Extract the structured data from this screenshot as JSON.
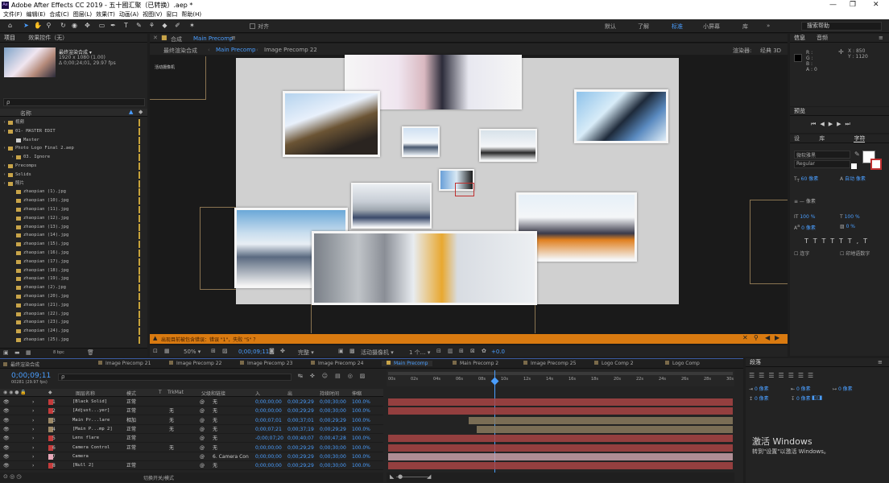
{
  "window": {
    "title": "Adobe After Effects CC 2019 - 五十國汇聚（已转换）.aep *",
    "logo": "Ae"
  },
  "menu": [
    "文件(F)",
    "编辑(E)",
    "合成(C)",
    "图层(L)",
    "效果(T)",
    "动画(A)",
    "视图(V)",
    "窗口",
    "帮助(H)"
  ],
  "toolbar": {
    "align_label": "对齐",
    "workspaces": [
      "默认",
      "了解",
      "标准",
      "小屏幕",
      "库"
    ],
    "active_workspace": "标准",
    "search_placeholder": "搜索帮助",
    "chevron": "»"
  },
  "project": {
    "tab_project": "项目",
    "tab_effects": "效果控件（无）",
    "comp_name": "最终渲染合成",
    "comp_res": "1920 x 1080 (1.00)",
    "comp_dur": "Δ 0;00;24;01, 29.97 fps",
    "search_icon": "ρ",
    "col_name": "名称",
    "items": [
      {
        "label": "视频",
        "type": "folder",
        "indent": 0
      },
      {
        "label": "01- MASTER EDIT",
        "type": "folder",
        "indent": 0
      },
      {
        "label": "Master",
        "type": "comp",
        "indent": 1
      },
      {
        "label": "Photo Logo Final 2.aep",
        "type": "folder",
        "indent": 0
      },
      {
        "label": "03. Ignore",
        "type": "folder",
        "indent": 1
      },
      {
        "label": "Precomps",
        "type": "folder",
        "indent": 0
      },
      {
        "label": "Solids",
        "type": "folder",
        "indent": 0
      },
      {
        "label": "照片",
        "type": "folder",
        "indent": 0
      },
      {
        "label": "zhaopian (1).jpg",
        "type": "jpg",
        "indent": 1
      },
      {
        "label": "zhaopian (10).jpg",
        "type": "jpg",
        "indent": 1
      },
      {
        "label": "zhaopian (11).jpg",
        "type": "jpg",
        "indent": 1
      },
      {
        "label": "zhaopian (12).jpg",
        "type": "jpg",
        "indent": 1
      },
      {
        "label": "zhaopian (13).jpg",
        "type": "jpg",
        "indent": 1
      },
      {
        "label": "zhaopian (14).jpg",
        "type": "jpg",
        "indent": 1
      },
      {
        "label": "zhaopian (15).jpg",
        "type": "jpg",
        "indent": 1
      },
      {
        "label": "zhaopian (16).jpg",
        "type": "jpg",
        "indent": 1
      },
      {
        "label": "zhaopian (17).jpg",
        "type": "jpg",
        "indent": 1
      },
      {
        "label": "zhaopian (18).jpg",
        "type": "jpg",
        "indent": 1
      },
      {
        "label": "zhaopian (19).jpg",
        "type": "jpg",
        "indent": 1
      },
      {
        "label": "zhaopian (2).jpg",
        "type": "jpg",
        "indent": 1
      },
      {
        "label": "zhaopian (20).jpg",
        "type": "jpg",
        "indent": 1
      },
      {
        "label": "zhaopian (21).jpg",
        "type": "jpg",
        "indent": 1
      },
      {
        "label": "zhaopian (22).jpg",
        "type": "jpg",
        "indent": 1
      },
      {
        "label": "zhaopian (23).jpg",
        "type": "jpg",
        "indent": 1
      },
      {
        "label": "zhaopian (24).jpg",
        "type": "jpg",
        "indent": 1
      },
      {
        "label": "zhaopian (25).jpg",
        "type": "jpg",
        "indent": 1
      }
    ],
    "bpc": "8 bpc"
  },
  "viewer": {
    "tab": "合成",
    "tab_comp": "Main Precomp",
    "breadcrumbs": [
      "最终渲染合成",
      "Main Precomp",
      "Image Precomp 22"
    ],
    "renderer_label": "渲染器:",
    "renderer": "经典 3D",
    "active_camera": "活动摄像机",
    "warning": "出现目前被包含错误：错误 \"1\"，失败 \"5\" ？",
    "zoom": "50%",
    "timecode": "0;00;09;11",
    "resolution": "完整",
    "camera": "活动摄像机",
    "views": "1 个…",
    "exposure": "+0.0"
  },
  "info": {
    "tab_info": "信息",
    "tab_audio": "音频",
    "r": "R :",
    "g": "G :",
    "b": "B :",
    "a": "A : 0",
    "x": "X : 850",
    "y": "Y : 1120"
  },
  "preview": {
    "tab": "预览"
  },
  "character": {
    "tab_left": "设",
    "tab_lib": "库",
    "tab": "字符",
    "font": "微软雅黑",
    "style": "Regular",
    "size": "60 像素",
    "leading": "自动 像素",
    "tracking_unit": "像素",
    "vscale": "100 %",
    "hscale": "100 %",
    "baseline": "0 像素",
    "tsume": "0 %",
    "ligature": "连字",
    "hindi": "印地语数字"
  },
  "paragraph": {
    "tab": "段落",
    "indent1": "0 像素",
    "indent2": "0 像素",
    "indent3": "0 像素",
    "indent4": "0 像素",
    "indent5": "0 像素"
  },
  "timeline": {
    "tabs": [
      "最终渲染合成",
      "Image Precomp 21",
      "Image Precomp 22",
      "Image Precomp 23",
      "Image Precomp 24",
      "Main Precomp",
      "Main Precomp 2",
      "Image Precomp 25",
      "Logo Comp 2",
      "Logo Comp"
    ],
    "active_tab": "Main Precomp",
    "timecode": "0;00;09;11",
    "frame_info": "00281 (29.97 fps)",
    "cols": {
      "layer_name": "图层名称",
      "mode": "模式",
      "t": "T",
      "trkmat": "TrkMat",
      "parent": "父级和链接",
      "in": "入",
      "out": "出",
      "duration": "持续时间",
      "stretch": "伸缩"
    },
    "ruler": [
      "00s",
      "02s",
      "04s",
      "06s",
      "08s",
      "10s",
      "12s",
      "14s",
      "16s",
      "18s",
      "20s",
      "22s",
      "24s",
      "26s",
      "28s",
      "30s"
    ],
    "layers": [
      {
        "num": "1",
        "name": "[Black Solid]",
        "color": "#c43b3b",
        "mode": "正常",
        "trk": "",
        "parent": "无",
        "in": "0;00;00;00",
        "out": "0;00;29;29",
        "dur": "0;00;30;00",
        "stretch": "100.0%"
      },
      {
        "num": "2",
        "name": "[Adjust...yer]",
        "color": "#c43b3b",
        "mode": "正常",
        "trk": "无",
        "parent": "无",
        "in": "0;00;00;00",
        "out": "0;00;29;29",
        "dur": "0;00;30;00",
        "stretch": "100.0%"
      },
      {
        "num": "3",
        "name": "Main Pr...lare",
        "color": "#9c8866",
        "mode": "相加",
        "trk": "无",
        "parent": "无",
        "in": "0;00;07;01",
        "out": "0;00;37;01",
        "dur": "0;00;29;29",
        "stretch": "100.0%"
      },
      {
        "num": "4",
        "name": "[Main P...mp 2]",
        "color": "#9c8866",
        "mode": "正常",
        "trk": "无",
        "parent": "无",
        "in": "0;00;07;21",
        "out": "0;00;37;19",
        "dur": "0;00;29;29",
        "stretch": "100.0%"
      },
      {
        "num": "5",
        "name": "Lens flare",
        "color": "#c43b3b",
        "mode": "正常",
        "trk": "",
        "parent": "无",
        "in": "-0;00;07;20",
        "out": "0;00;40;07",
        "dur": "0;00;47;28",
        "stretch": "100.0%"
      },
      {
        "num": "6",
        "name": "Camera Control",
        "color": "#c43b3b",
        "mode": "正常",
        "trk": "无",
        "parent": "无",
        "in": "0;00;00;00",
        "out": "0;00;29;29",
        "dur": "0;00;30;00",
        "stretch": "100.0%"
      },
      {
        "num": "7",
        "name": "Camera",
        "color": "#e8a8b8",
        "mode": "",
        "trk": "",
        "parent": "6. Camera Con",
        "in": "0;00;00;00",
        "out": "0;00;29;29",
        "dur": "0;00;30;00",
        "stretch": "100.0%"
      },
      {
        "num": "8",
        "name": "[Null 2]",
        "color": "#c43b3b",
        "mode": "正常",
        "trk": "",
        "parent": "无",
        "in": "0;00;00;00",
        "out": "0;00;29;29",
        "dur": "0;00;30;00",
        "stretch": "100.0%"
      }
    ],
    "footer": "切换开关/模式"
  },
  "windows_watermark": {
    "line1": "激活 Windows",
    "line2": "转到\"设置\"以激活 Windows。"
  }
}
